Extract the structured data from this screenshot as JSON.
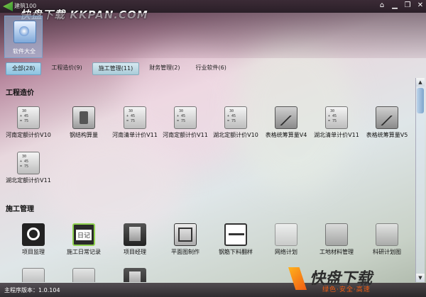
{
  "window": {
    "title": "建筑100",
    "watermark": "快盘下载 KKPAN.COM"
  },
  "header": {
    "software_all_label": "软件大全"
  },
  "tabs": [
    {
      "label": "全部(28)"
    },
    {
      "label": "工程造价(9)"
    },
    {
      "label": "施工管理(11)"
    },
    {
      "label": "财务管理(2)"
    },
    {
      "label": "行业软件(6)"
    }
  ],
  "sections": {
    "cost": {
      "title": "工程造价",
      "items": [
        {
          "label": "河南定额计价V10",
          "icon": "calculator-icon"
        },
        {
          "label": "钢结构算量",
          "icon": "steel-structure-icon"
        },
        {
          "label": "河南清单计价V11",
          "icon": "calculator-icon"
        },
        {
          "label": "河南定额计价V11",
          "icon": "calculator-icon"
        },
        {
          "label": "湖北定额计价V10",
          "icon": "calculator-icon"
        },
        {
          "label": "表格统筹算量V4",
          "icon": "chart-icon"
        },
        {
          "label": "湖北清单计价V11",
          "icon": "calculator-icon"
        },
        {
          "label": "表格统筹算量V5",
          "icon": "chart-icon"
        },
        {
          "label": "湖北定额计价V11",
          "icon": "calculator-icon"
        }
      ]
    },
    "construction": {
      "title": "施工管理",
      "items": [
        {
          "label": "项目监理",
          "icon": "search-icon"
        },
        {
          "label": "施工日常记录",
          "icon": "diary-icon"
        },
        {
          "label": "项目经理",
          "icon": "manager-icon"
        },
        {
          "label": "平面图制作",
          "icon": "floor-plan-icon"
        },
        {
          "label": "钢筋下料翻样",
          "icon": "rebar-icon"
        },
        {
          "label": "网络计划",
          "icon": "network-plan-icon"
        },
        {
          "label": "工地材料管理",
          "icon": "tools-icon"
        },
        {
          "label": "科研计划图",
          "icon": "research-icon"
        }
      ]
    }
  },
  "status": {
    "text": "主程序版本：1.0.104"
  },
  "brand": {
    "name": "快盘下载",
    "slogan": "绿色·安全·高速"
  },
  "colors": {
    "tab_active": "#8cc3e0",
    "brand_orange": "#f15c12"
  }
}
